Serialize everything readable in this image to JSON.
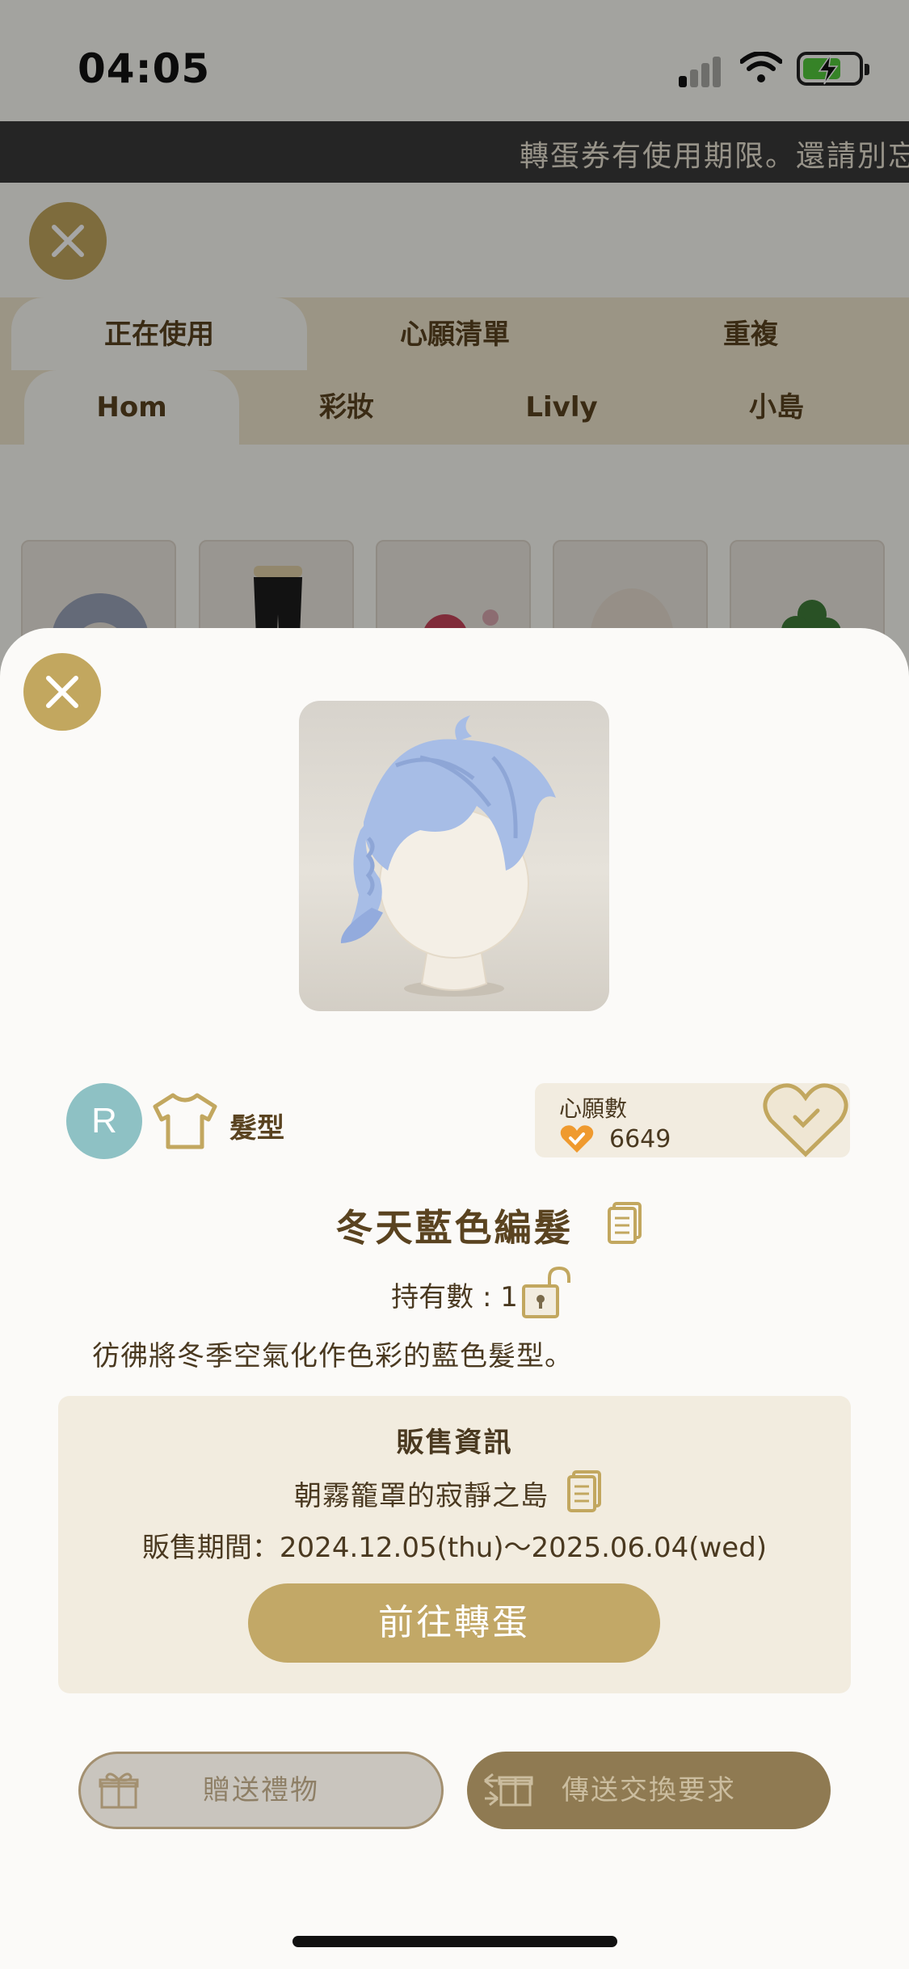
{
  "status_bar": {
    "time": "04:05"
  },
  "ticker": {
    "text": "轉蛋券有使用期限。還請別忘了"
  },
  "main_tabs": [
    "正在使用",
    "心願清單",
    "重複"
  ],
  "sub_tabs": [
    "Hom",
    "彩妝",
    "Livly",
    "小島"
  ],
  "item": {
    "rarity": "R",
    "category": "髮型",
    "wishlist_label": "心願數",
    "wishlist_count": "6649",
    "name": "冬天藍色編髮",
    "owned": "持有數 : 1",
    "description": "彷彿將冬季空氣化作色彩的藍色髮型。"
  },
  "sale": {
    "title": "販售資訊",
    "island": "朝霧籠罩的寂靜之島",
    "period": "販售期間：2024.12.05(thu)～2025.06.04(wed)",
    "go_button": "前往轉蛋"
  },
  "actions": {
    "gift": "贈送禮物",
    "trade": "傳送交換要求"
  },
  "colors": {
    "accent_gold": "#c2a75f",
    "text_brown": "#5a4320",
    "rarity_teal": "#8ec1c4"
  }
}
